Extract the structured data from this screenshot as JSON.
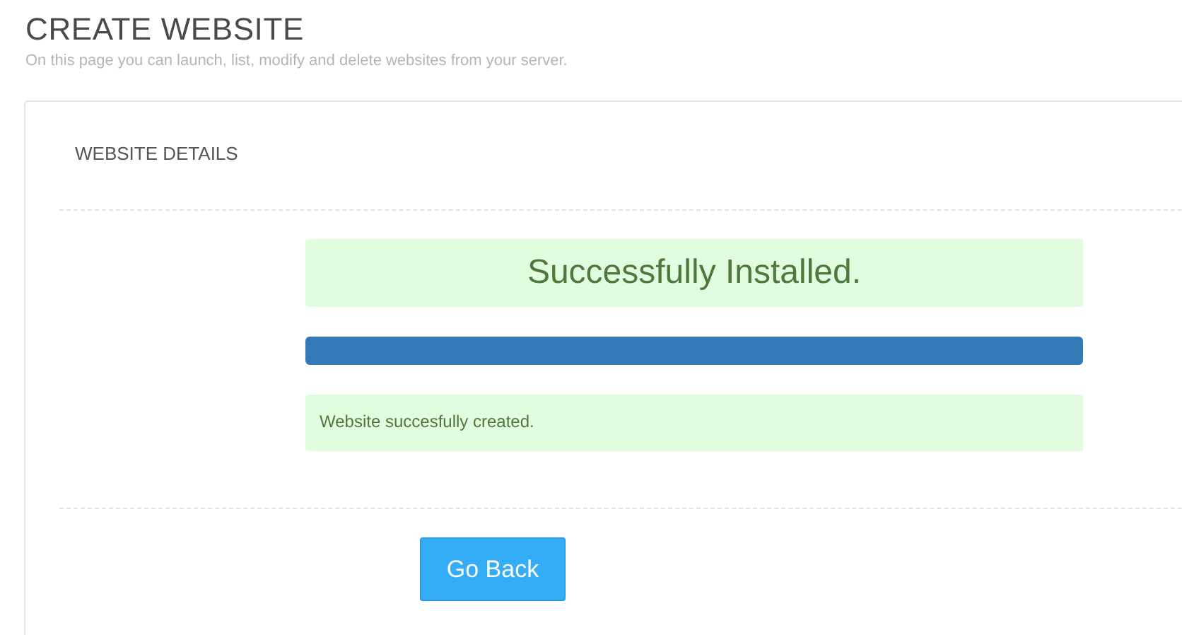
{
  "page": {
    "title": "CREATE WEBSITE",
    "subtitle": "On this page you can launch, list, modify and delete websites from your server."
  },
  "card": {
    "title": "WEBSITE DETAILS",
    "status_banner": "Successfully Installed.",
    "progress": {
      "level": 1
    },
    "alert": "Website succesfully created.",
    "button": "Go Back"
  }
}
